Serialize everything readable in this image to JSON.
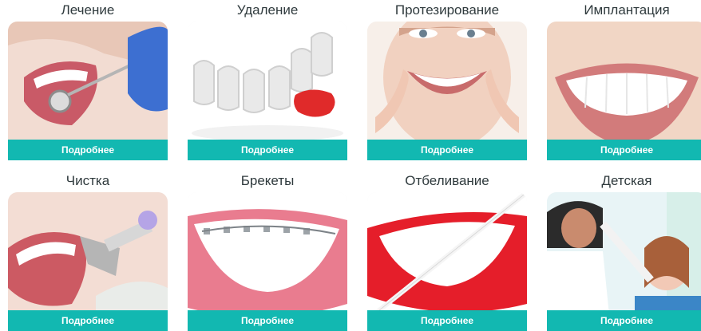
{
  "services": [
    {
      "title": "Лечение",
      "button": "Подробнее",
      "image": "dental-treatment-mirror"
    },
    {
      "title": "Удаление",
      "button": "Подробнее",
      "image": "tooth-removal-model"
    },
    {
      "title": "Протезирование",
      "button": "Подробнее",
      "image": "smiling-woman"
    },
    {
      "title": "Имплантация",
      "button": "Подробнее",
      "image": "white-teeth-smile"
    },
    {
      "title": "Чистка",
      "button": "Подробнее",
      "image": "teeth-cleaning-drill"
    },
    {
      "title": "Брекеты",
      "button": "Подробнее",
      "image": "braces-smile"
    },
    {
      "title": "Отбеливание",
      "button": "Подробнее",
      "image": "whitening-floss-smile"
    },
    {
      "title": "Детская",
      "button": "Подробнее",
      "image": "child-dentist"
    }
  ],
  "colors": {
    "accent": "#12b8b1",
    "title": "#2f3a3d"
  }
}
